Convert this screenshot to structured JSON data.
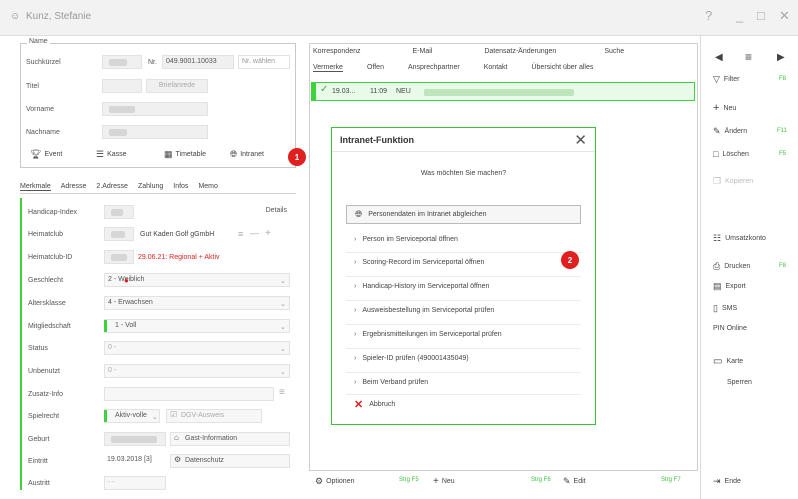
{
  "window": {
    "title": "Kunz, Stefanie",
    "help": "?",
    "minimize": "_",
    "maximize": "□",
    "close": "✕"
  },
  "name_group": {
    "legend": "Name",
    "suchkuerzel_label": "Suchkürzel",
    "nr_label": "Nr.",
    "nr_value": "049.9001.10033",
    "nr_waehlen": "Nr. wählen",
    "titel_label": "Titel",
    "briefanrede": "Briefanrede",
    "vorname_label": "Vorname",
    "nachname_label": "Nachname",
    "buttons": [
      "Event",
      "Kasse",
      "Timetable",
      "Intranet"
    ]
  },
  "left_tabs": [
    "Merkmale",
    "Adresse",
    "2.Adresse",
    "Zahlung",
    "Infos",
    "Memo"
  ],
  "fields": {
    "handicap_label": "Handicap-Index",
    "details": "Details",
    "heimatclub_label": "Heimatclub",
    "heimatclub_value": "Gut Kaden Golf gGmbH",
    "heimatclub_id_label": "Heimatclub-ID",
    "heimatclub_id_value": "29.06.21: Regional + Aktiv",
    "geschlecht_label": "Geschlecht",
    "geschlecht_value": "2 - Weiblich",
    "altersklasse_label": "Altersklasse",
    "altersklasse_value": "4 - Erwachsen",
    "mitgliedschaft_label": "Mitgliedschaft",
    "mitgliedschaft_value": "1 - Voll",
    "status_label": "Status",
    "status_value": "0 -",
    "unbenutzt_label": "Unbenutzt",
    "unbenutzt_value": "0 -",
    "zusatzinfo_label": "Zusatz-Info",
    "spielrecht_label": "Spielrecht",
    "spielrecht_value": "Aktiv-volle",
    "dgv_ausweis": "DGV-Ausweis",
    "geburt_label": "Geburt",
    "gast_information": "Gast-Information",
    "eintritt_label": "Eintritt",
    "eintritt_value": "19.03.2018 [3]",
    "datenschutz": "Datenschutz",
    "austritt_label": "Austritt",
    "austritt_value": "- -"
  },
  "right_tabs_row1": [
    "Korrespondenz",
    "E-Mail",
    "Datensatz-Änderungen",
    "Suche"
  ],
  "right_tabs_row2": [
    "Vermerke",
    "Offen",
    "Ansprechpartner",
    "Kontakt",
    "Übersicht über alles"
  ],
  "vermerk_row": {
    "date": "19.03...",
    "time": "11:09",
    "tag": "NEU"
  },
  "dialog": {
    "title": "Intranet-Funktion",
    "question": "Was möchten Sie machen?",
    "options": [
      "Personendaten im Intranet abgleichen",
      "Person im Serviceportal öffnen",
      "Scoring-Record im Serviceportal öffnen",
      "Handicap-History im Serviceportal öffnen",
      "Ausweisbestellung im Serviceportal prüfen",
      "Ergebnismitteilungen im Serviceportal prüfen",
      "Spieler-ID prüfen (490001435049)",
      "Beim Verband prüfen"
    ],
    "abort": "Abbruch"
  },
  "badges": [
    "1",
    "2"
  ],
  "right_sidebar": {
    "filter": "Filter",
    "filter_key": "F8",
    "neu": "Neu",
    "aendern": "Ändern",
    "aendern_key": "F11",
    "loeschen": "Löschen",
    "loeschen_key": "F5",
    "kopieren": "Kopieren",
    "umsatzkonto": "Umsatzkonto",
    "drucken": "Drucken",
    "drucken_key": "F8",
    "export": "Export",
    "sms": "SMS",
    "pin_online": "PIN Online",
    "karte": "Karte",
    "sperren": "Sperren",
    "ende": "Ende"
  },
  "bottom_toolbar": {
    "optionen": "Optionen",
    "neu": "Neu",
    "edit": "Edit",
    "key1": "Strg F5",
    "key2": "Strg F6",
    "key3": "Strg F7"
  },
  "colors": {
    "accent_green": "#3cd23c",
    "badge_red": "#e0201f",
    "warning_red": "#e0201f"
  }
}
